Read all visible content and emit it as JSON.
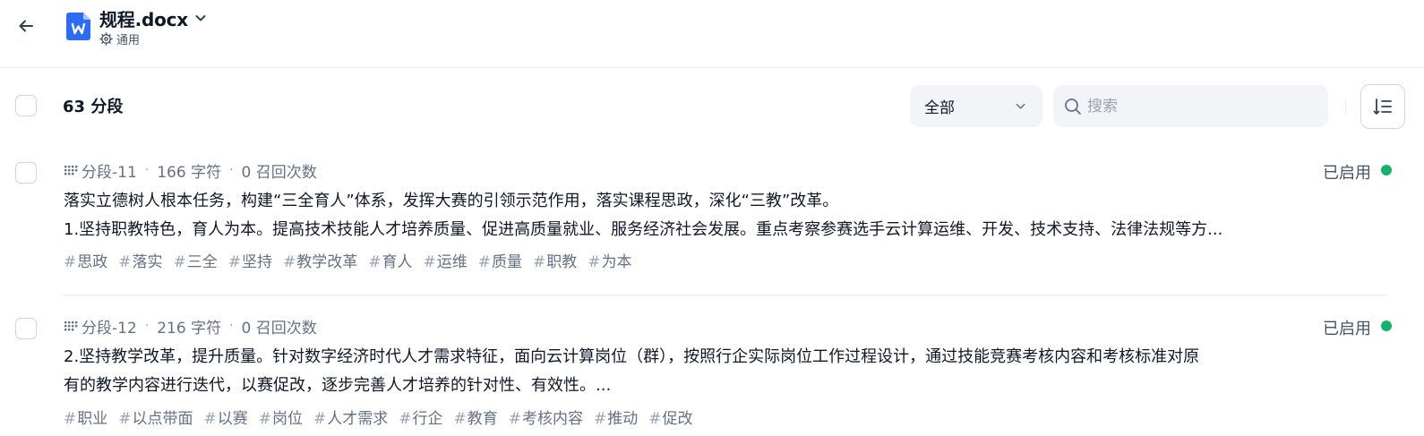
{
  "header": {
    "doc_name": "规程.docx",
    "mode_label": "通用"
  },
  "toolbar": {
    "segment_count": "63 分段",
    "filter_selected": "全部",
    "search_placeholder": "搜索"
  },
  "segments": [
    {
      "id": "分段-11",
      "chars": "166 字符",
      "recalls": "0 召回次数",
      "status": "已启用",
      "lines": [
        "落实立德树人根本任务，构建“三全育人”体系，发挥大赛的引领示范作用，落实课程思政，深化“三教”改革。",
        "1.坚持职教特色，育人为本。提高技术技能人才培养质量、促进高质量就业、服务经济社会发展。重点考察参赛选手云计算运维、开发、技术支持、法律法规等方..."
      ],
      "tags": [
        "思政",
        "落实",
        "三全",
        "坚持",
        "教学改革",
        "育人",
        "运维",
        "质量",
        "职教",
        "为本"
      ]
    },
    {
      "id": "分段-12",
      "chars": "216 字符",
      "recalls": "0 召回次数",
      "status": "已启用",
      "lines": [
        "2.坚持教学改革，提升质量。针对数字经济时代人才需求特征，面向云计算岗位（群），按照行企实际岗位工作过程设计，通过技能竞赛考核内容和考核标准对原",
        "有的教学内容进行迭代，以赛促改，逐步完善人才培养的针对性、有效性。..."
      ],
      "tags": [
        "职业",
        "以点带面",
        "以赛",
        "岗位",
        "人才需求",
        "行企",
        "教育",
        "考核内容",
        "推动",
        "促改"
      ]
    }
  ],
  "colors": {
    "accent_blue": "#2e6bf5",
    "status_green": "#17b26a",
    "text_primary": "#101828",
    "text_secondary": "#667085"
  },
  "icons": [
    "arrow-left-icon",
    "word-doc-icon",
    "chevron-down-icon",
    "gear-icon",
    "search-icon",
    "sort-list-icon",
    "grid-dots-icon"
  ]
}
